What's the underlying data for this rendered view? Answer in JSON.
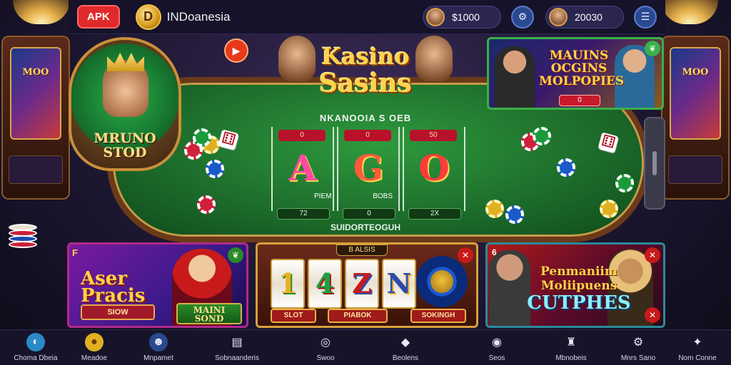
{
  "topbar": {
    "apk_label": "APK",
    "region_name": "INDoanesia",
    "coin_logo_glyph": "D",
    "balance_1": "$1000",
    "balance_2": "20030",
    "icon_1": "settings-icon",
    "icon_2": "menu-icon"
  },
  "side_cabinets": {
    "left_label": "MOO",
    "right_label": "MOO"
  },
  "medallion": {
    "title_line1": "MRUNO",
    "title_line2": "STOD"
  },
  "hero_logo": {
    "line1": "Kasino",
    "line2": "Sasins"
  },
  "promo_top_right": {
    "title_line1": "MAUINS",
    "title_line2": "OCGINS",
    "title_line3": "MOLPOPIES",
    "button_label": "0"
  },
  "table": {
    "header": "NKANOOIA S OEB",
    "footer": "SUIDORTEOGUH",
    "mid_left": "PIEM",
    "mid_right": "BOBS",
    "lanes": [
      {
        "tag": "0",
        "letter": "A",
        "bet": "72"
      },
      {
        "tag": "0",
        "letter": "G",
        "bet": "0"
      },
      {
        "tag": "50",
        "letter": "O",
        "bet": "2X"
      }
    ]
  },
  "cards": {
    "card1": {
      "flag": "F",
      "title_line1": "Aser",
      "title_line2": "Pracis",
      "button_label": "SIOW",
      "banner_line1": "MAINI",
      "banner_line2": "SOND"
    },
    "card2": {
      "badge": "B ALSIS",
      "reels": [
        "1",
        "4",
        "Z",
        "N"
      ],
      "button_1": "SLOT",
      "button_2": "PIABOK",
      "button_3": "SOKINGH"
    },
    "card3": {
      "flag": "6",
      "title_line1": "Penmaniim",
      "title_line2": "Moliipuens",
      "title_line3": "CUTPHES"
    }
  },
  "nav": {
    "items": [
      {
        "label": "Choma Dbeia",
        "icon": "globe-icon",
        "glyph": "◐"
      },
      {
        "label": "Meadoe",
        "icon": "coin-icon",
        "glyph": "●"
      },
      {
        "label": "Mnpamet",
        "icon": "user-icon",
        "glyph": "☻"
      },
      {
        "label": "Sobnaanderis",
        "icon": "document-icon",
        "glyph": "▤"
      },
      {
        "label": "Swoo",
        "icon": "location-icon",
        "glyph": "◎"
      },
      {
        "label": "Beolens",
        "icon": "diamond-icon",
        "glyph": "◆"
      },
      {
        "label": "Seos",
        "icon": "chat-icon",
        "glyph": "◉"
      },
      {
        "label": "Mbnobeis",
        "icon": "profile-icon",
        "glyph": "♜"
      },
      {
        "label": "Mnrs Sano",
        "icon": "gear-icon",
        "glyph": "⚙"
      },
      {
        "label": "Nom Conne",
        "icon": "puzzle-icon",
        "glyph": "✦"
      }
    ]
  },
  "colors": {
    "background": "#1c1630",
    "felt": "#2e9a3e",
    "accent_red": "#e02a2a",
    "accent_gold": "#ffd24a"
  }
}
